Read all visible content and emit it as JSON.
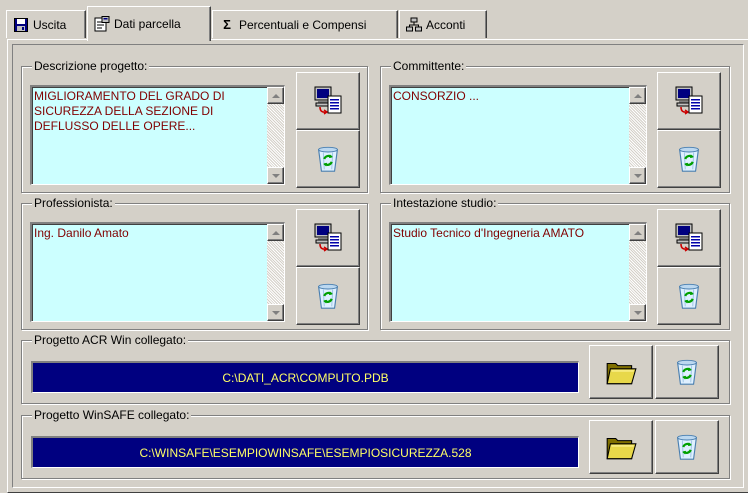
{
  "tabs": [
    {
      "label": "Uscita",
      "icon": "floppy-disk-icon"
    },
    {
      "label": "Dati parcella",
      "icon": "properties-icon"
    },
    {
      "label": "Percentuali e Compensi",
      "icon": "sigma-icon",
      "prefix": "Σ"
    },
    {
      "label": "Acconti",
      "icon": "network-icon"
    }
  ],
  "active_tab": "Dati parcella",
  "groups": {
    "descrizione": {
      "label": "Descrizione progetto:",
      "text": "MIGLIORAMENTO DEL GRADO DI\nSICUREZZA DELLA SEZIONE DI\nDEFLUSSO DELLE OPERE..."
    },
    "committente": {
      "label": "Committente:",
      "text": "CONSORZIO ..."
    },
    "professionista": {
      "label": "Professionista:",
      "text": "Ing. Danilo Amato"
    },
    "intestazione": {
      "label": "Intestazione studio:",
      "text": "Studio Tecnico d'Ingegneria AMATO"
    },
    "acr": {
      "label": "Progetto ACR Win collegato:",
      "path": "C:\\DATI_ACR\\COMPUTO.PDB"
    },
    "winsafe": {
      "label": "Progetto WinSAFE collegato:",
      "path": "C:\\WINSAFE\\ESEMPIOWINSAFE\\ESEMPIOSICUREZZA.528"
    }
  },
  "colors": {
    "memo_bg": "#ccffff",
    "memo_text": "#800000",
    "path_bg": "#000080",
    "path_text": "#ffff66",
    "face": "#d4d0c8"
  }
}
